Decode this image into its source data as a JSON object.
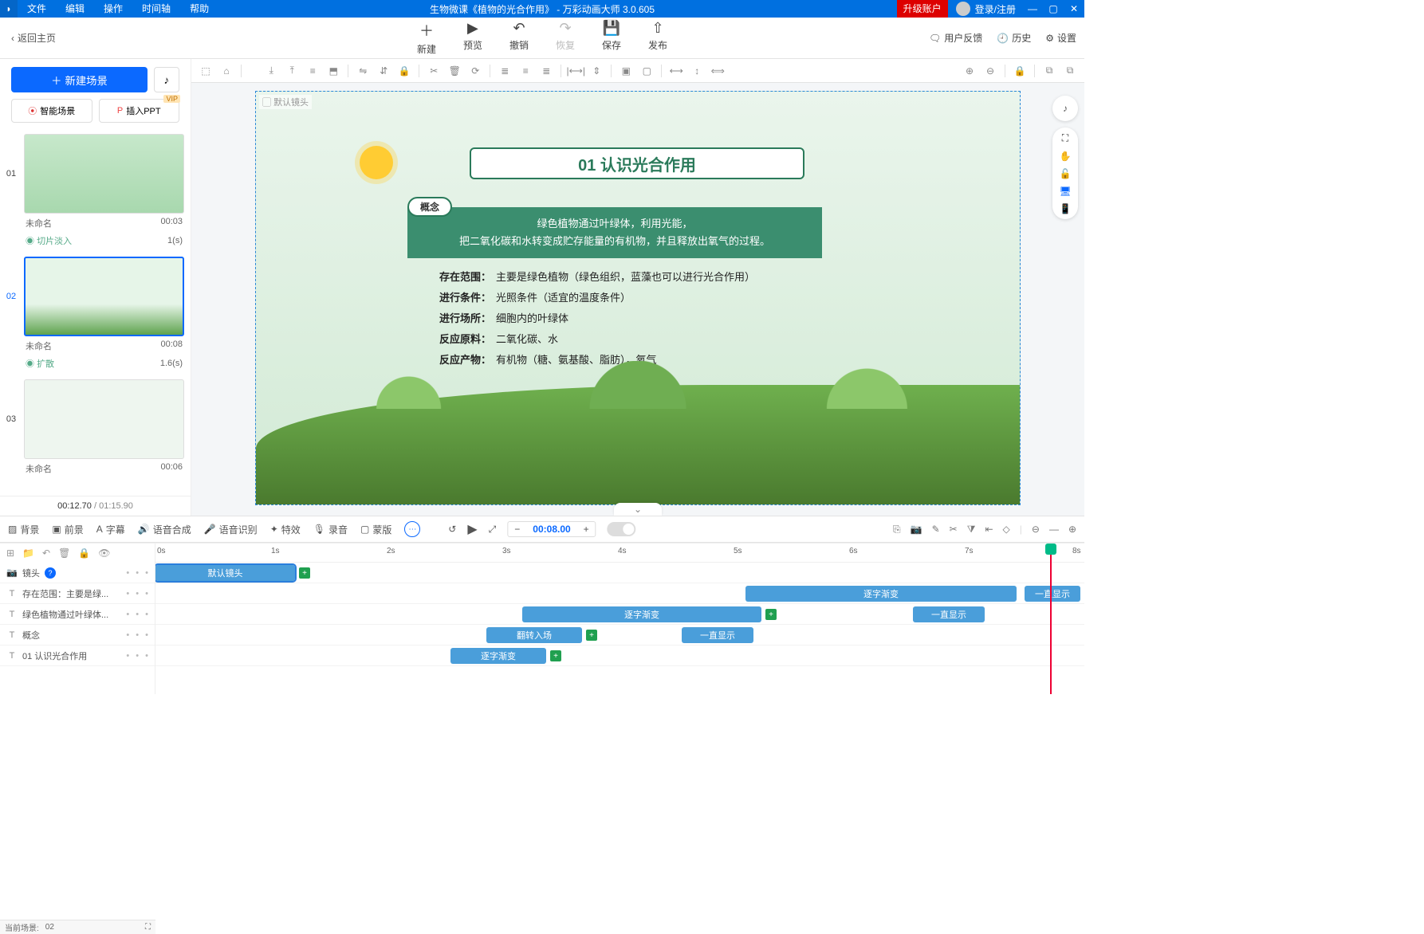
{
  "menubar": {
    "items": [
      "文件",
      "编辑",
      "操作",
      "时间轴",
      "帮助"
    ],
    "title": "生物微课《植物的光合作用》 - 万彩动画大师 3.0.605",
    "upgrade": "升级账户",
    "login": "登录/注册"
  },
  "toolbar": {
    "back": "返回主页",
    "buttons": [
      {
        "icon": "＋",
        "label": "新建"
      },
      {
        "icon": "▶",
        "label": "预览"
      },
      {
        "icon": "↶",
        "label": "撤销"
      },
      {
        "icon": "↷",
        "label": "恢复",
        "disabled": true
      },
      {
        "icon": "💾",
        "label": "保存"
      },
      {
        "icon": "⇧",
        "label": "发布"
      }
    ],
    "right": [
      {
        "icon": "🗨",
        "label": "用户反馈"
      },
      {
        "icon": "🕘",
        "label": "历史"
      },
      {
        "icon": "⚙",
        "label": "设置"
      }
    ]
  },
  "sidebar": {
    "newscene": "新建场景",
    "ai_scene": "智能场景",
    "insert_ppt": "插入PPT",
    "vip": "VIP",
    "scenes": [
      {
        "num": "01",
        "name": "未命名",
        "dur": "00:03",
        "trans": "切片淡入",
        "trans_t": "1(s)"
      },
      {
        "num": "02",
        "name": "未命名",
        "dur": "00:08",
        "trans": "扩散",
        "trans_t": "1.6(s)",
        "selected": true
      },
      {
        "num": "03",
        "name": "未命名",
        "dur": "00:06"
      }
    ],
    "cur_time": "00:12.70",
    "total_time": "/ 01:15.90"
  },
  "canvas": {
    "cam_label": "默认镜头",
    "title": "01 认识光合作用",
    "concept_tag": "概念",
    "concept_line1": "绿色植物通过叶绿体，利用光能，",
    "concept_line2": "把二氧化碳和水转变成贮存能量的有机物，并且释放出氧气的过程。",
    "rows": [
      {
        "k": "存在范围：",
        "v": "主要是绿色植物（绿色组织，蓝藻也可以进行光合作用）"
      },
      {
        "k": "进行条件：",
        "v": "光照条件（适宜的温度条件）"
      },
      {
        "k": "进行场所：",
        "v": "细胞内的叶绿体"
      },
      {
        "k": "反应原料：",
        "v": "二氧化碳、水"
      },
      {
        "k": "反应产物：",
        "v": "有机物（糖、氨基酸、脂肪），氧气"
      }
    ]
  },
  "tl_tabs": {
    "items": [
      {
        "icon": "▨",
        "label": "背景"
      },
      {
        "icon": "▣",
        "label": "前景"
      },
      {
        "icon": "A",
        "label": "字幕"
      },
      {
        "icon": "🔊",
        "label": "语音合成"
      },
      {
        "icon": "🎤",
        "label": "语音识别"
      },
      {
        "icon": "✦",
        "label": "特效"
      },
      {
        "icon": "🎙",
        "label": "录音"
      },
      {
        "icon": "▢",
        "label": "蒙版"
      }
    ],
    "time": "00:08.00"
  },
  "ruler": [
    "0s",
    "1s",
    "2s",
    "3s",
    "4s",
    "5s",
    "6s",
    "7s",
    "8s"
  ],
  "tracks": {
    "toolrow_icons": [
      "⇱",
      "⇲",
      "↶",
      "🗑",
      "🔒",
      "👁"
    ],
    "rows": [
      {
        "icon": "📷",
        "label": "镜头"
      },
      {
        "icon": "T",
        "label": "存在范围：主要是绿..."
      },
      {
        "icon": "T",
        "label": "绿色植物通过叶绿体..."
      },
      {
        "icon": "T",
        "label": "概念"
      },
      {
        "icon": "T",
        "label": "01 认识光合作用"
      }
    ],
    "clips": {
      "cam": {
        "label": "默认镜头"
      },
      "r1": [
        {
          "label": "逐字渐变"
        },
        {
          "label": "一直显示"
        }
      ],
      "r2": [
        {
          "label": "逐字渐变"
        },
        {
          "label": "一直显示"
        }
      ],
      "r3": [
        {
          "label": "翻转入场"
        },
        {
          "label": "一直显示"
        }
      ],
      "r4": [
        {
          "label": "逐字渐变"
        }
      ]
    }
  },
  "status": {
    "label": "当前场景:",
    "val": "02"
  }
}
